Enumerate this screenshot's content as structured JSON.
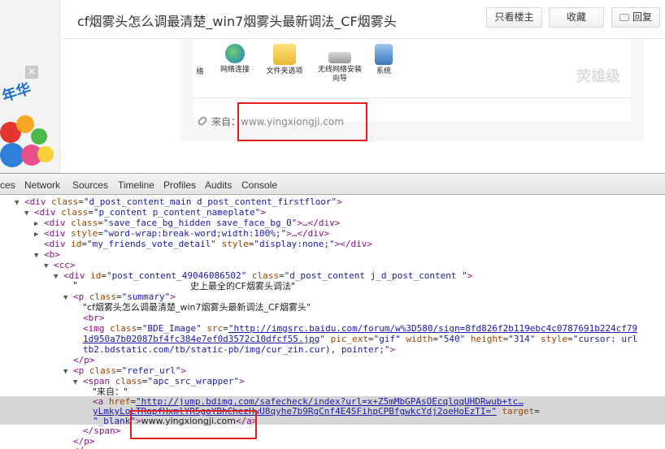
{
  "page": {
    "title": "cf烟雾头怎么调最清楚_win7烟雾头最新调法_CF烟雾头",
    "buttons": {
      "only_louzhu": "只看楼主",
      "favorite": "收藏",
      "reply": "回复"
    },
    "ad": {
      "close": "×",
      "text": "年华"
    },
    "desktop_items": [
      "络",
      "网络连接",
      "文件夹选项",
      "无线网络安装向导",
      "系统"
    ],
    "watermark": "荧雄级",
    "source_label": "来自：",
    "source_url": "www.yingxiongji.com"
  },
  "devtools": {
    "tabs": [
      "ces",
      "Network",
      "Sources",
      "Timeline",
      "Profiles",
      "Audits",
      "Console"
    ],
    "lines": {
      "l1_tag": "<div ",
      "l1_attr": "class",
      "l1_val": "\"d_post_content_main d_post_content_firstfloor\"",
      "l1_end": ">",
      "l2_tag": "<div ",
      "l2_attr": "class",
      "l2_val": "\"p_content p_content_nameplate\"",
      "l2_end": ">",
      "l3_tag": "<div ",
      "l3_attr": "class",
      "l3_val": "\"save_face_bg_hidden save_face_bg_0\"",
      "l3_end": ">…</div>",
      "l4_tag": "<div ",
      "l4_attr": "style",
      "l4_val": "\"word-wrap:break-word;width:100%;\"",
      "l4_end": ">…</div>",
      "l5_tag": "<div ",
      "l5_attr": "id",
      "l5_val": "\"my_friends_vote_detail\"",
      "l5_attr2": "style",
      "l5_val2": "\"display:none;\"",
      "l5_end": "></div>",
      "l6": "<b>",
      "l7": "<cc>",
      "l8_tag": "<div ",
      "l8_attr": "id",
      "l8_val": "\"post_content_49046086502\"",
      "l8_attr2": "class",
      "l8_val2": "\"d_post_content j_d_post_content \"",
      "l8_end": ">",
      "l9_quote": "\"",
      "l9_text": "史上最全的CF烟雾头调法\"",
      "l10_tag": "<p ",
      "l10_attr": "class",
      "l10_val": "\"summary\"",
      "l10_end": ">",
      "l11": "\"cf烟雾头怎么调最清楚_win7烟雾头最新调法_CF烟雾头\"",
      "l12": "<br>",
      "l13_tag": "<img ",
      "l13_attr": "class",
      "l13_val": "\"BDE_Image\"",
      "l13_attr2": "src",
      "l13_url": "\"http://imgsrc.baidu.com/forum/w%3D580/sign=8fd826f2b119ebc4c0787691b224cf79",
      "l14_url": "1d950a7b02087bf4fc384e7ef0d3572c10dfcf55.jpg",
      "l14_attr": " pic_ext",
      "l14_val": "\"gif\"",
      "l14_attr2": " width",
      "l14_val2": "\"540\"",
      "l14_attr3": " height",
      "l14_val3": "\"314\"",
      "l14_attr4": " style",
      "l14_val4": "\"cursor: url",
      "l15": "tb2.bdstatic.com/tb/static-pb/img/cur_zin.cur), pointer;\"",
      "l15_end": ">",
      "l16": "</p>",
      "l17_tag": "<p ",
      "l17_attr": "class",
      "l17_val": "\"refer_url\"",
      "l17_end": ">",
      "l18_tag": "<span ",
      "l18_attr": "class",
      "l18_val": "\"apc_src_wrapper\"",
      "l18_end": ">",
      "l19": "\"来自：\"",
      "l20_tag": "<a ",
      "l20_attr": "href",
      "l20_url": "\"http://jump.bdimg.com/safecheck/index?url=x+Z5mMbGPAsOEcqlqqUHDRwub+tc…",
      "l21_url": "yLmkyLoLTRapfHxmlYR5goYBhChezHwU8qyhe7b9RgCnf4E4SFihpCPBfgwkcYdj2oeHoEzTI=\"",
      "l21_attr": " target",
      "l22_val": "\"_blank\"",
      "l22_mid": ">",
      "l22_text": "www.yingxiongji.com",
      "l22_end": "</a>",
      "l23": "</span>",
      "l24": "</p>",
      "l25": "</"
    }
  }
}
